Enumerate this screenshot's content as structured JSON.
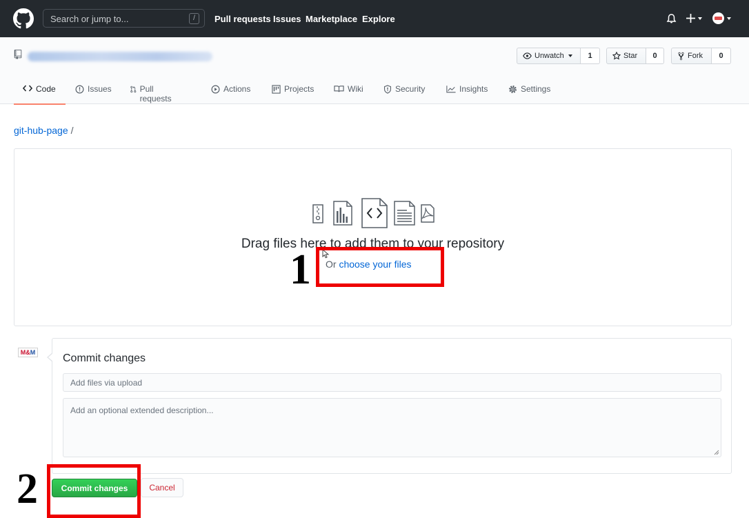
{
  "header": {
    "search_placeholder": "Search or jump to...",
    "search_shortcut": "/",
    "nav": [
      "Pull requests",
      "Issues",
      "Marketplace",
      "Explore"
    ],
    "icons": [
      "github-logo-icon",
      "bell-icon",
      "plus-icon",
      "avatar-icon"
    ]
  },
  "repo": {
    "actions": {
      "watch_label": "Unwatch",
      "watch_count": "1",
      "star_label": "Star",
      "star_count": "0",
      "fork_label": "Fork",
      "fork_count": "0"
    },
    "tabs": [
      "Code",
      "Issues",
      "Pull requests",
      "Actions",
      "Projects",
      "Wiki",
      "Security",
      "Insights",
      "Settings"
    ],
    "selected_tab": "Code"
  },
  "breadcrumb": {
    "repo": "git-hub-page",
    "separator": "/"
  },
  "upload": {
    "title": "Drag files here to add them to your repository",
    "choose_prefix": "Or ",
    "choose_link": "choose your files"
  },
  "commit": {
    "avatar_text_1": "M&",
    "avatar_text_2": "M",
    "title": "Commit changes",
    "summary_placeholder": "Add files via upload",
    "description_placeholder": "Add an optional extended description...",
    "commit_button": "Commit changes",
    "cancel_button": "Cancel"
  },
  "annotations": {
    "step_1": "1",
    "step_2": "2",
    "color": "#ee0000"
  },
  "colors": {
    "header_bg": "#24292e",
    "link": "#0366d6",
    "commit_green": "#28a745",
    "tab_underline": "#f9826c",
    "cancel_red": "#cb2431"
  }
}
